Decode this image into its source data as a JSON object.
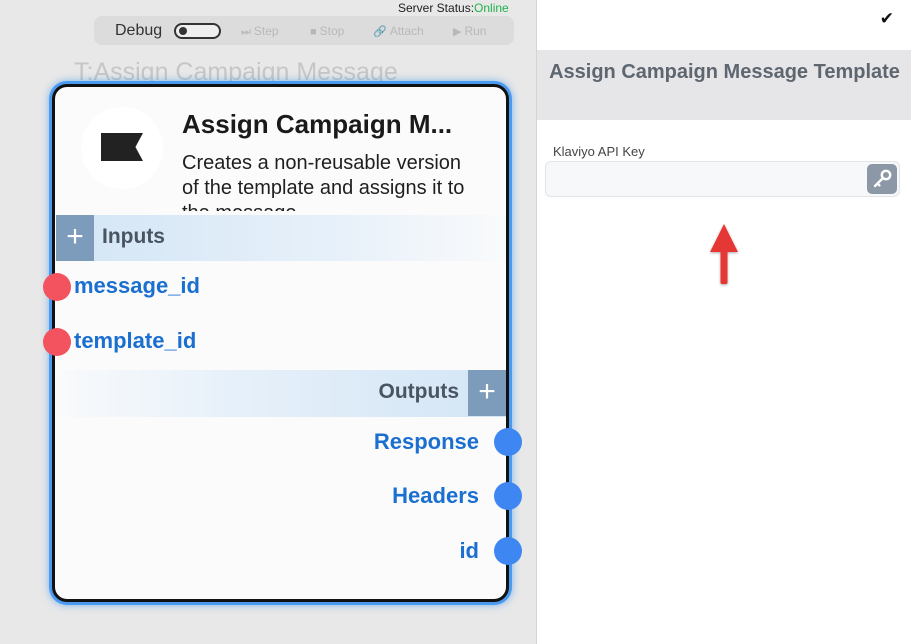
{
  "server_status": {
    "label": "Server Status:",
    "value": "Online",
    "online_color": "#22b14c"
  },
  "toolbar": {
    "debug_label": "Debug",
    "debug_enabled": false,
    "buttons": [
      {
        "label": "Step",
        "icon": "step-icon"
      },
      {
        "label": "Stop",
        "icon": "stop-icon"
      },
      {
        "label": "Attach",
        "icon": "attach-icon"
      },
      {
        "label": "Run",
        "icon": "run-icon"
      }
    ]
  },
  "canvas": {
    "node_title": "T:Assign Campaign Message Template"
  },
  "node": {
    "name": "Assign Campaign M...",
    "description": "Creates a non-reusable version of the template and assigns it to the message.",
    "logo_icon": "klaviyo-flag-icon",
    "inputs_label": "Inputs",
    "outputs_label": "Outputs",
    "inputs": [
      {
        "label": "message_id"
      },
      {
        "label": "template_id"
      }
    ],
    "outputs": [
      {
        "label": "Response"
      },
      {
        "label": "Headers"
      },
      {
        "label": "id"
      }
    ],
    "input_port_color": "#f2535e",
    "output_port_color": "#3e87f2",
    "selection_color": "#4a9bf0"
  },
  "panel": {
    "confirm_icon": "checkmark-icon",
    "title": "Assign Campaign Message Template",
    "field": {
      "label": "Klaviyo API Key",
      "value": "",
      "placeholder": "",
      "button_icon": "key-icon"
    },
    "annotation_arrow_color": "#e53935"
  }
}
